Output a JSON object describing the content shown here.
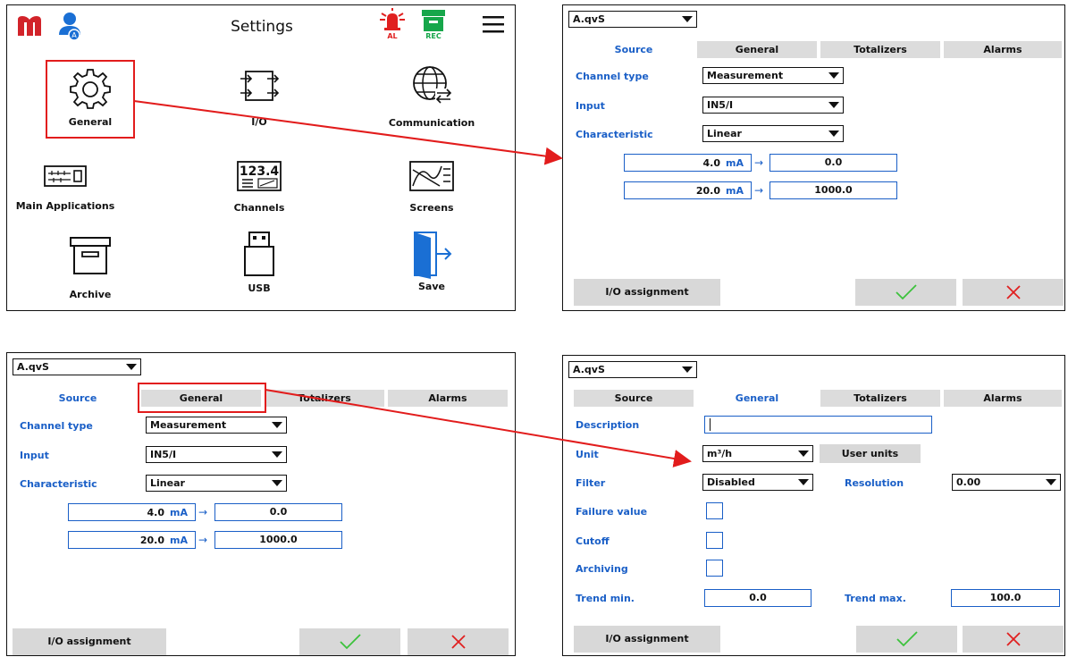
{
  "settings": {
    "title": "Settings",
    "al_label": "AL",
    "rec_label": "REC",
    "menu": [
      "General",
      "I/O",
      "Communication",
      "Main Applications",
      "Channels",
      "Screens",
      "Archive",
      "USB",
      "Save"
    ],
    "channels_icon_text": "123.4"
  },
  "channel": {
    "selector": "A.qvS",
    "tabs": [
      "Source",
      "General",
      "Totalizers",
      "Alarms"
    ],
    "source": {
      "labels": [
        "Channel type",
        "Input",
        "Characteristic"
      ],
      "values": [
        "Measurement",
        "IN5/I",
        "Linear"
      ],
      "rows": [
        {
          "in": "4.0",
          "unit": "mA",
          "out": "0.0"
        },
        {
          "in": "20.0",
          "unit": "mA",
          "out": "1000.0"
        }
      ]
    },
    "general": {
      "labels": [
        "Description",
        "Unit",
        "Filter",
        "Failure value",
        "Cutoff",
        "Archiving",
        "Trend min."
      ],
      "unit_value": "m³/h",
      "user_units_button": "User units",
      "filter_value": "Disabled",
      "resolution_label": "Resolution",
      "resolution_value": "0.00",
      "trend_min": "0.0",
      "trend_max_label": "Trend max.",
      "trend_max": "100.0"
    },
    "io_button": "I/O assignment"
  },
  "colors": {
    "accent": "#1a5fc7",
    "ok": "#3cc23c",
    "cancel": "#e02020",
    "highlight": "#e21c1c"
  }
}
